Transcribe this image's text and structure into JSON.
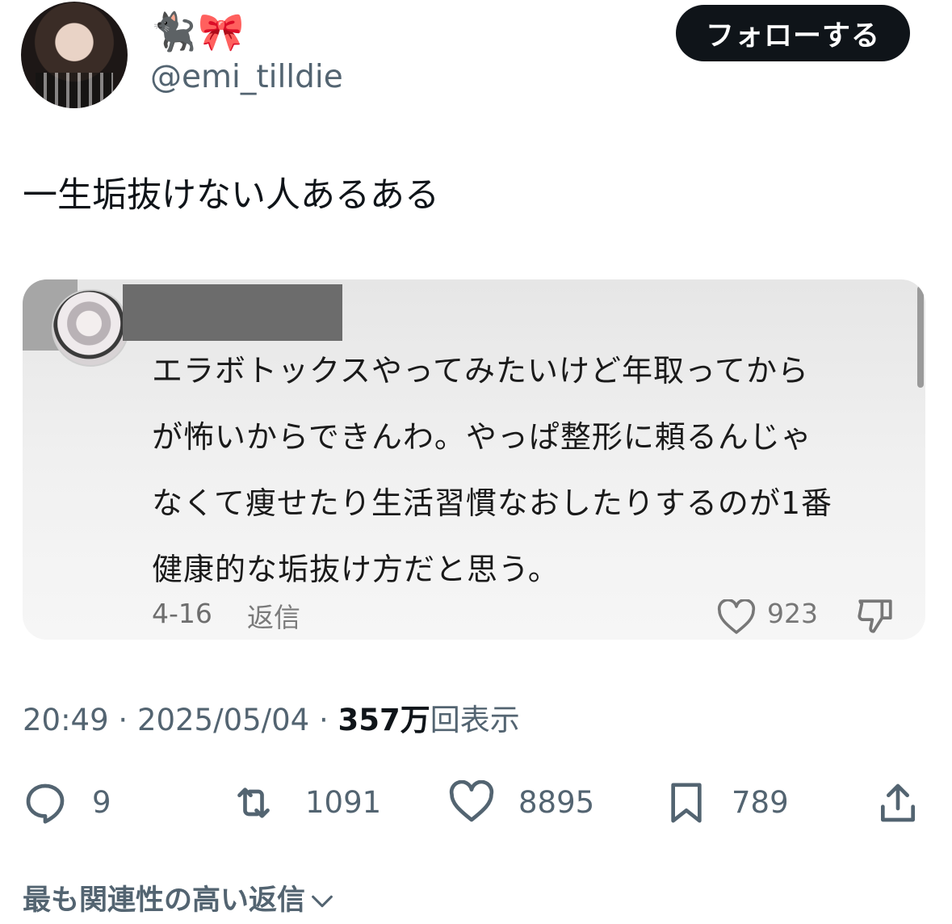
{
  "profile": {
    "display_name": "🐈‍⬛🎀",
    "handle": "@emi_tilldie",
    "follow_label": "フォローする"
  },
  "tweet": {
    "text": "一生垢抜けない人あるある",
    "time": "20:49",
    "date": "2025/05/04",
    "views_count": "357万",
    "views_label": "回表示"
  },
  "embedded_comment": {
    "lines": [
      "エラボトックスやってみたいけど年取ってから",
      "が怖いからできんわ。やっぱ整形に頼るんじゃ",
      "なくて痩せたり生活習慣なおしたりするのが1番",
      "健康的な垢抜け方だと思う。"
    ],
    "date": "4-16",
    "reply_label": "返信",
    "likes": "923"
  },
  "actions": {
    "replies": "9",
    "retweets": "1091",
    "likes": "8895",
    "bookmarks": "789"
  },
  "footer": {
    "relevant_replies_label": "最も関連性の高い返信"
  },
  "icons": {
    "reply": "reply-icon",
    "retweet": "retweet-icon",
    "like": "heart-icon",
    "bookmark": "bookmark-icon",
    "share": "share-icon",
    "dislike": "thumbs-down-icon",
    "chevron": "chevron-down-icon"
  },
  "colors": {
    "follow_button_bg": "#0f1419",
    "secondary_text": "#536471",
    "card_bg": "#f1f1f1"
  }
}
